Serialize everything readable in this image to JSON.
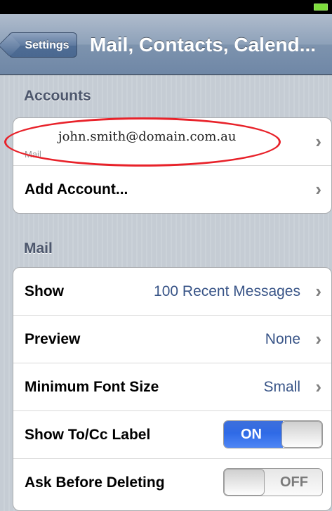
{
  "navbar": {
    "back_label": "Settings",
    "title": "Mail, Contacts, Calend..."
  },
  "accounts": {
    "header": "Accounts",
    "account_email": "john.smith@domain.com.au",
    "account_sub": "Mail",
    "add_account_label": "Add Account..."
  },
  "mail": {
    "header": "Mail",
    "show_label": "Show",
    "show_value": "100 Recent Messages",
    "preview_label": "Preview",
    "preview_value": "None",
    "min_font_label": "Minimum Font Size",
    "min_font_value": "Small",
    "show_tocc_label": "Show To/Cc Label",
    "show_tocc_state": "ON",
    "ask_delete_label": "Ask Before Deleting",
    "ask_delete_state": "OFF"
  },
  "chevron": "›",
  "colors": {
    "annotation_oval": "#e8222a",
    "toggle_on": "#2f6ae6",
    "value_text": "#385487"
  }
}
